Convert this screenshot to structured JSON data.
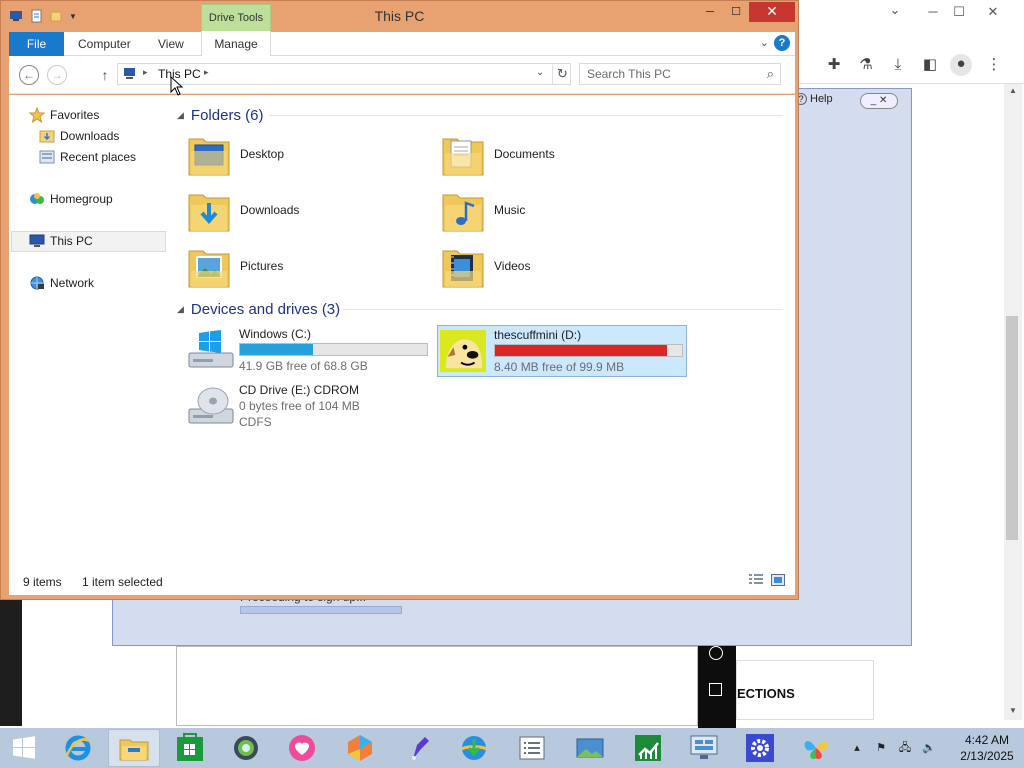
{
  "window": {
    "title": "This PC",
    "contextual_tab": "Drive Tools",
    "close_glyph": "✕",
    "min_glyph": "─",
    "max_glyph": "☐"
  },
  "ribbon": {
    "tabs": [
      "File",
      "Computer",
      "View",
      "Manage"
    ]
  },
  "address": {
    "path": "This PC",
    "search_placeholder": "Search This PC"
  },
  "nav_pane": {
    "items": [
      {
        "label": "Favorites",
        "icon": "star-icon"
      },
      {
        "label": "Downloads",
        "icon": "downloads-folder-icon"
      },
      {
        "label": "Recent places",
        "icon": "recent-places-icon"
      },
      {
        "label": "Homegroup",
        "icon": "homegroup-icon"
      },
      {
        "label": "This PC",
        "icon": "computer-icon"
      },
      {
        "label": "Network",
        "icon": "network-icon"
      }
    ]
  },
  "folders": {
    "header": "Folders (6)",
    "items": [
      {
        "name": "Desktop",
        "icon": "desktop-folder-icon"
      },
      {
        "name": "Documents",
        "icon": "documents-folder-icon"
      },
      {
        "name": "Downloads",
        "icon": "downloads-folder-icon"
      },
      {
        "name": "Music",
        "icon": "music-folder-icon"
      },
      {
        "name": "Pictures",
        "icon": "pictures-folder-icon"
      },
      {
        "name": "Videos",
        "icon": "videos-folder-icon"
      }
    ]
  },
  "drives": {
    "header": "Devices and drives (3)",
    "items": [
      {
        "name": "Windows (C:)",
        "free": "41.9 GB free of 68.8 GB",
        "used_fraction": 0.39,
        "bar_color": "#26a0da",
        "selected": false
      },
      {
        "name": "thescuffmini (D:)",
        "free": "8.40 MB free of 99.9 MB",
        "used_fraction": 0.92,
        "bar_color": "#da2626",
        "selected": true
      },
      {
        "name": "CD Drive (E:) CDROM",
        "free": "0 bytes free of 104 MB",
        "filesystem": "CDFS"
      }
    ]
  },
  "status": {
    "count": "9 items",
    "selected": "1 item selected"
  },
  "background": {
    "help_label": "Help",
    "progress_text": "Proceeding to sign up...",
    "sections_text": "ECTIONS"
  },
  "taskbar": {
    "time": "4:42 AM",
    "date": "2/13/2025",
    "apps": [
      "internet-explorer-icon",
      "file-explorer-icon",
      "store-icon",
      "app-globe-icon",
      "heart-app-icon",
      "colorful-app-icon",
      "pen-app-icon",
      "download-manager-icon",
      "notes-app-icon",
      "photos-app-icon",
      "chart-app-icon",
      "remote-desktop-icon",
      "settings-gear-icon",
      "butterfly-app-icon"
    ]
  },
  "colors": {
    "title_orange": "#e8a272",
    "accent_blue": "#1979ca",
    "drive_tools_green": "#bedf9a",
    "selection_blue": "#cce8ff"
  }
}
